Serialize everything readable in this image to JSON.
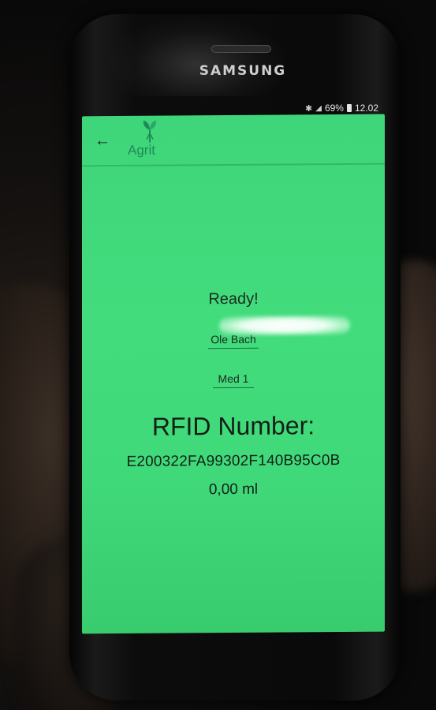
{
  "phone": {
    "brand": "SAMSUNG"
  },
  "status_bar": {
    "bluetooth_icon": "bluetooth-icon",
    "signal_icon": "signal-icon",
    "battery_percent": "69%",
    "battery_icon": "battery-icon",
    "time": "12.02"
  },
  "app_bar": {
    "back_icon": "back-arrow-icon",
    "logo_text": "Agrit",
    "logo_icon": "sprout-icon"
  },
  "main": {
    "status_text": "Ready!",
    "user_field_value": "Ole Bach",
    "medicine_field_value": "Med 1",
    "rfid_title": "RFID Number:",
    "rfid_number": "E200322FA99302F140B95C0B",
    "volume": "0,00 ml"
  },
  "colors": {
    "screen_background": "#42dc7c",
    "logo_green": "#1e8a5a",
    "text_dark": "#141f17"
  }
}
